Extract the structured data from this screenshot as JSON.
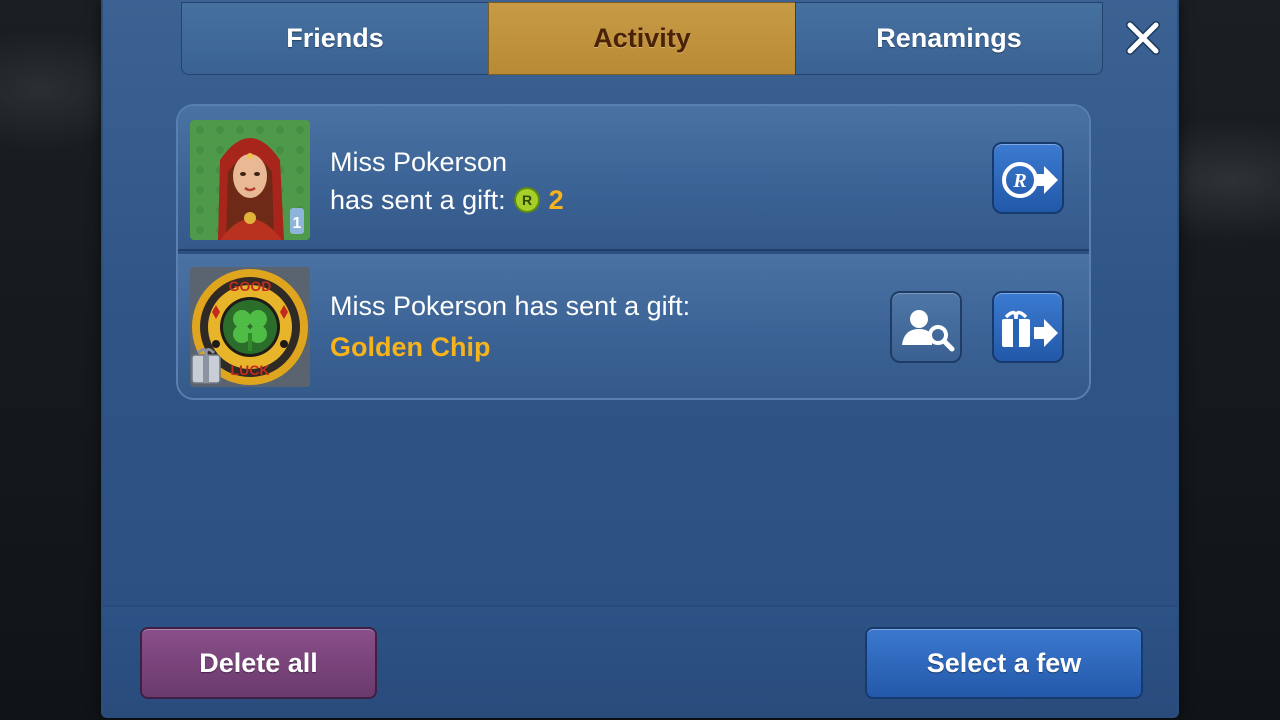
{
  "tabs": [
    {
      "label": "Friends",
      "active": false
    },
    {
      "label": "Activity",
      "active": true
    },
    {
      "label": "Renamings",
      "active": false
    }
  ],
  "notifications": [
    {
      "sender": "Miss Pokerson",
      "line2": "has sent a gift:",
      "coin_amount": "2",
      "coin_letter": "R",
      "avatar_badge": "1",
      "actions": [
        "send-rubies-back-icon"
      ]
    },
    {
      "text": "Miss Pokerson has sent a gift:",
      "gift_name": "Golden Chip",
      "chip_top_text": "GOOD",
      "chip_bottom_text": "LUCK",
      "actions": [
        "view-profile-icon",
        "send-gift-back-icon"
      ]
    }
  ],
  "footer": {
    "delete_label": "Delete all",
    "select_label": "Select a few"
  },
  "colors": {
    "panel": "#2f5486",
    "tab_active": "#c79b46",
    "gift_text": "#f6b31c",
    "delete_button": "#7a457c",
    "select_button": "#2d67bb"
  }
}
